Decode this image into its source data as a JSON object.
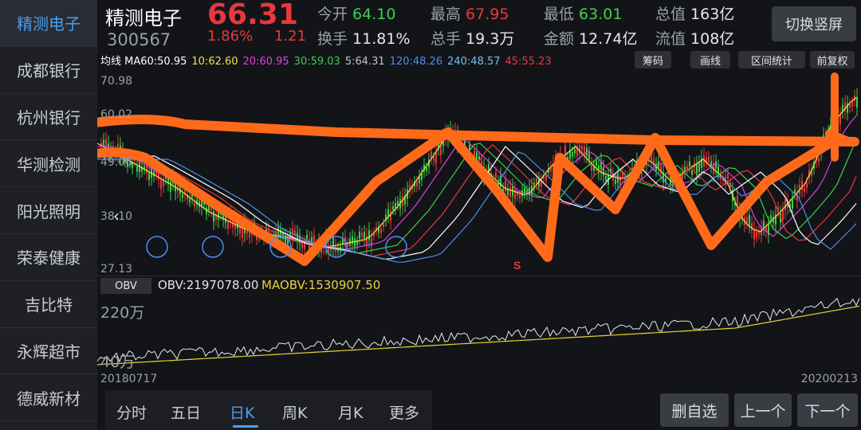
{
  "sidebar": {
    "items": [
      {
        "label": "精测电子",
        "active": true
      },
      {
        "label": "成都银行"
      },
      {
        "label": "杭州银行"
      },
      {
        "label": "华测检测"
      },
      {
        "label": "阳光照明"
      },
      {
        "label": "荣泰健康"
      },
      {
        "label": "吉比特"
      },
      {
        "label": "永辉超市"
      },
      {
        "label": "德威新材"
      }
    ]
  },
  "header": {
    "name": "精测电子",
    "code": "300567",
    "price": "66.31",
    "change_pct": "1.86%",
    "change": "1.21",
    "stats": [
      {
        "k": "今开",
        "v": "64.10",
        "color": "#3bd14a"
      },
      {
        "k": "最高",
        "v": "67.95",
        "color": "#e8383d"
      },
      {
        "k": "最低",
        "v": "63.01",
        "color": "#3bd14a"
      },
      {
        "k": "总值",
        "v": "163亿",
        "color": "#e6e8ec"
      },
      {
        "k": "换手",
        "v": "11.81%",
        "color": "#e6e8ec"
      },
      {
        "k": "总手",
        "v": "19.3万",
        "color": "#e6e8ec"
      },
      {
        "k": "金额",
        "v": "12.74亿",
        "color": "#e6e8ec"
      },
      {
        "k": "流值",
        "v": "108亿",
        "color": "#e6e8ec"
      }
    ],
    "switch_label": "切换竖屏"
  },
  "ma_line": [
    {
      "t": "均线 MA60:50.95",
      "color": "#ffffff"
    },
    {
      "t": "10:62.60",
      "color": "#f0e34a"
    },
    {
      "t": "20:60.95",
      "color": "#e040e0"
    },
    {
      "t": "30:59.03",
      "color": "#3bd14a"
    },
    {
      "t": "5:64.31",
      "color": "#c0c4cc"
    },
    {
      "t": "120:48.26",
      "color": "#4a8ff0"
    },
    {
      "t": "240:48.57",
      "color": "#6fc3f0"
    },
    {
      "t": "45:55.23",
      "color": "#e8383d"
    }
  ],
  "tools": [
    "筹码",
    "画线",
    "区间统计",
    "前复权"
  ],
  "price_labels": [
    "70.98",
    "60.02",
    "49.06",
    "38.10",
    "27.13"
  ],
  "signal_label": "S",
  "obv": {
    "tab": "OBV",
    "value": "OBV:2197078.00",
    "ma_value": "MAOBV:1530907.50",
    "labels": [
      "220万",
      "40万"
    ]
  },
  "dates": {
    "start": "20180717",
    "end": "20200213"
  },
  "periods": [
    "分时",
    "五日",
    "日K",
    "周K",
    "月K",
    "更多"
  ],
  "active_period": "日K",
  "buttons": {
    "remove": "删自选",
    "prev": "上一个",
    "next": "下一个"
  },
  "colors": {
    "up": "#e8383d",
    "down": "#3bd14a",
    "accent": "#4a9ef0",
    "annotation": "#ff6a1a"
  }
}
